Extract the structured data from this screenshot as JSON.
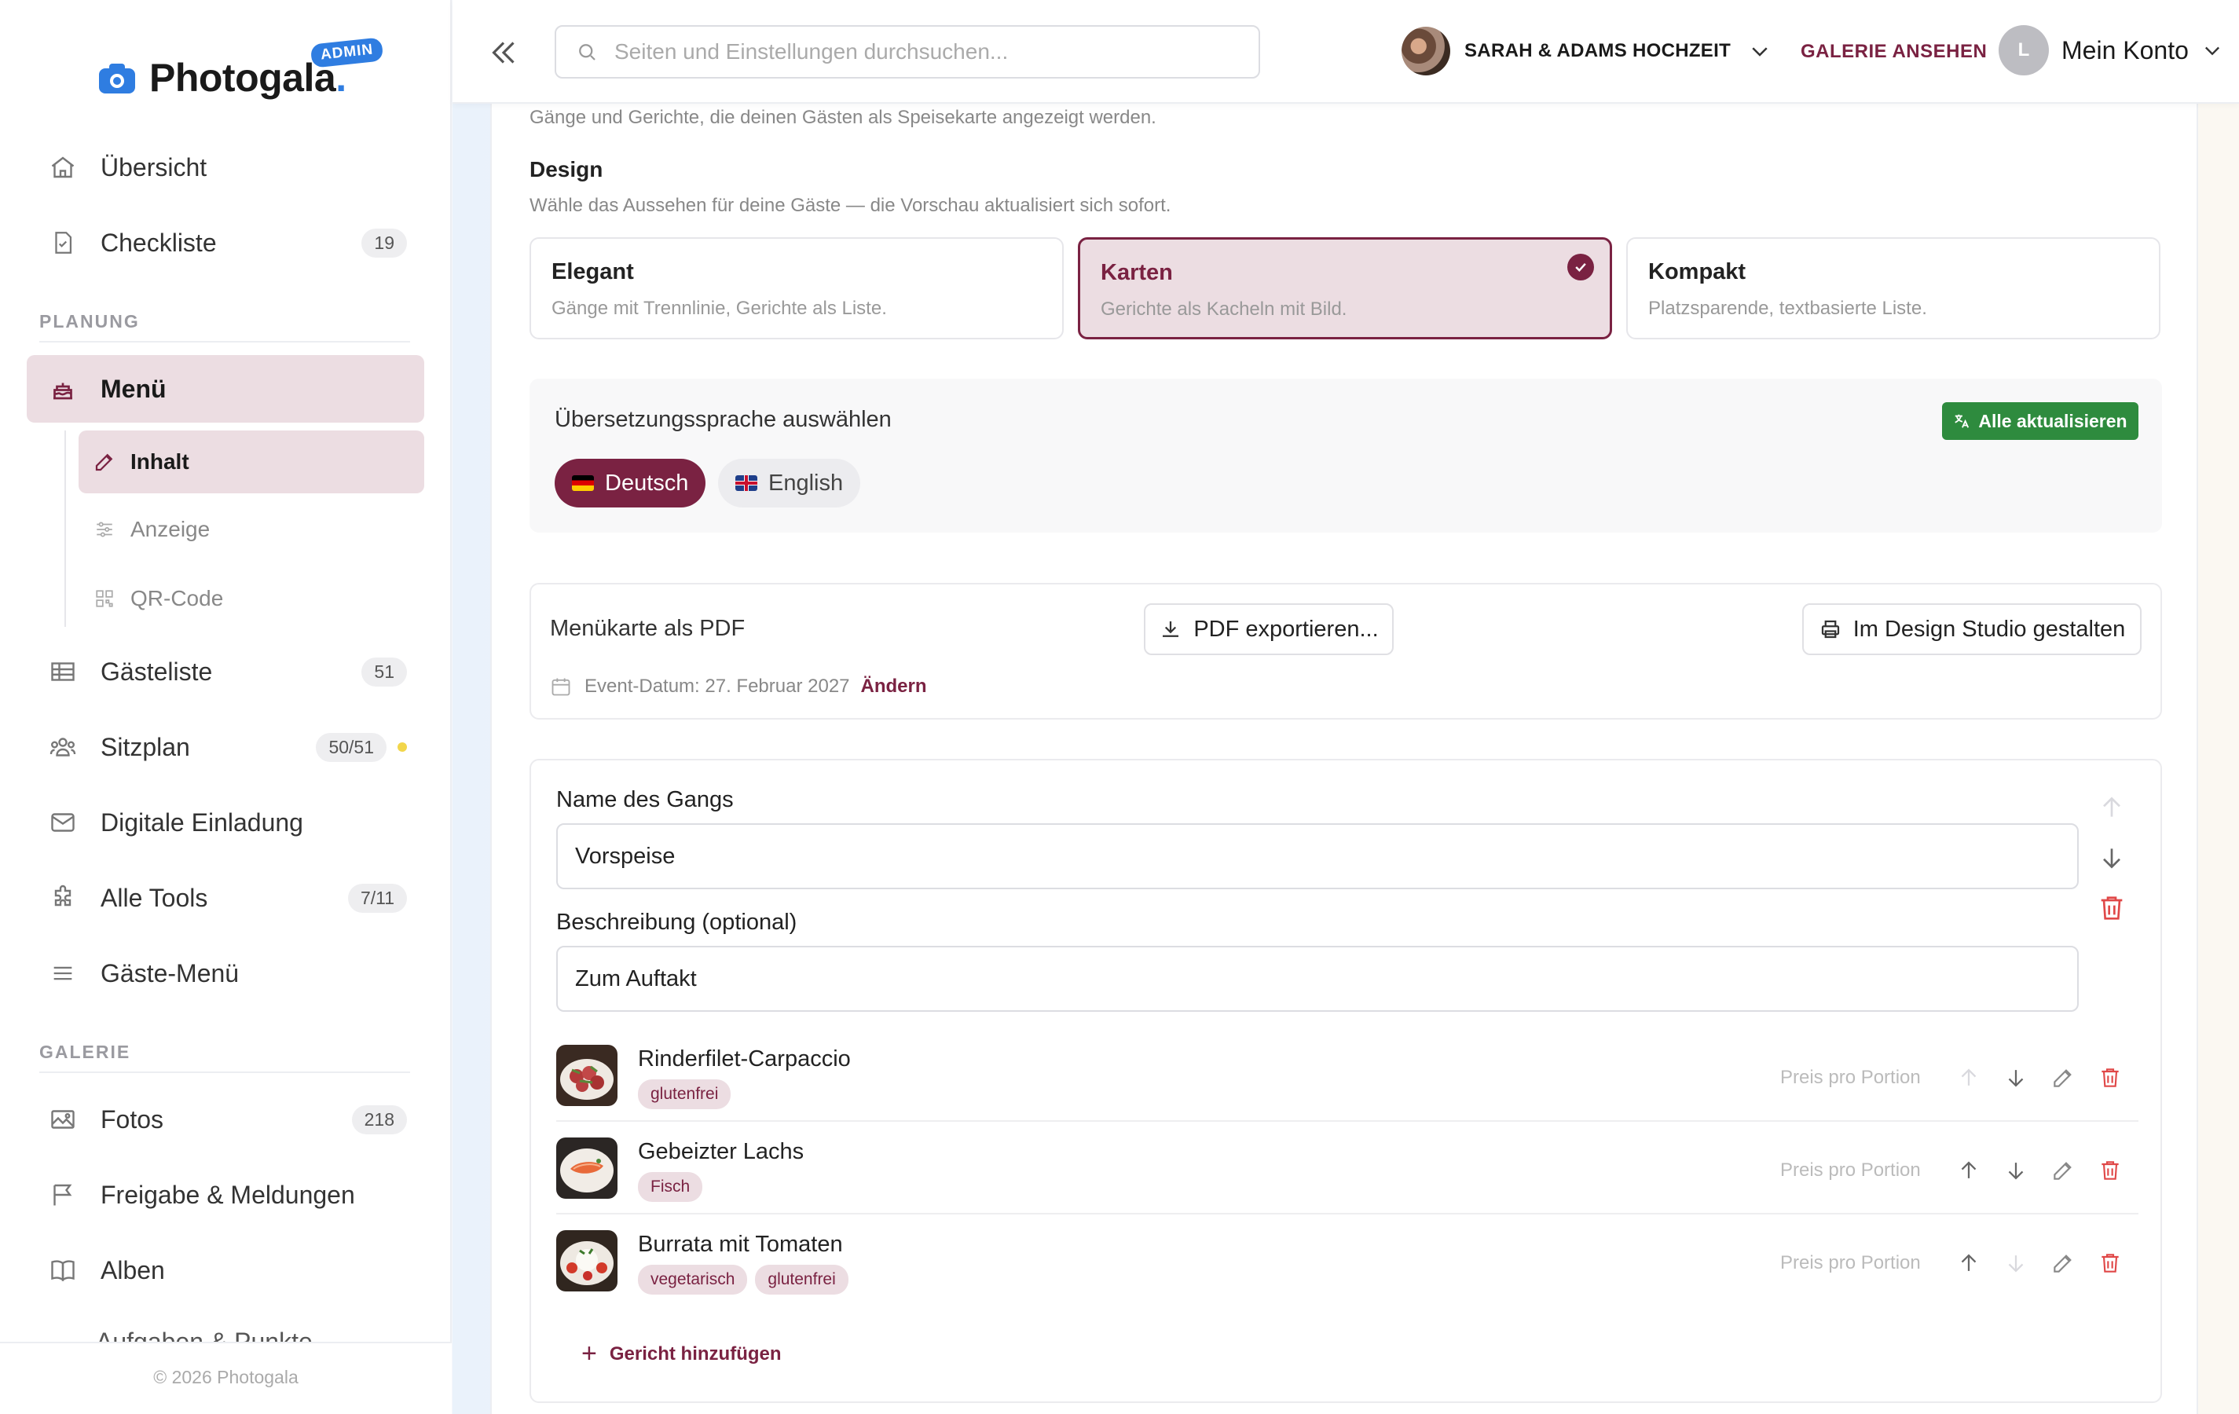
{
  "brand": {
    "name": "Photogala",
    "dot": ".",
    "badge": "ADMIN"
  },
  "sidebar": {
    "items_top": [
      {
        "label": "Übersicht",
        "icon": "home-icon"
      },
      {
        "label": "Checkliste",
        "icon": "checklist-icon",
        "count": "19"
      }
    ],
    "planning_label": "PLANUNG",
    "menu": {
      "label": "Menü",
      "icon": "cake-icon"
    },
    "menu_sub": [
      {
        "label": "Inhalt",
        "icon": "edit-icon"
      },
      {
        "label": "Anzeige",
        "icon": "sliders-icon"
      },
      {
        "label": "QR-Code",
        "icon": "qr-code-icon"
      }
    ],
    "items_planning": [
      {
        "label": "Gästeliste",
        "icon": "table-icon",
        "count": "51"
      },
      {
        "label": "Sitzplan",
        "icon": "people-icon",
        "count": "50/51"
      },
      {
        "label": "Digitale Einladung",
        "icon": "mail-icon"
      },
      {
        "label": "Alle Tools",
        "icon": "puzzle-icon",
        "count": "7/11"
      },
      {
        "label": "Gäste-Menü",
        "icon": "hamburger-icon"
      }
    ],
    "gallery_label": "GALERIE",
    "items_gallery": [
      {
        "label": "Fotos",
        "icon": "image-icon",
        "count": "218"
      },
      {
        "label": "Freigabe & Meldungen",
        "icon": "flag-icon"
      },
      {
        "label": "Alben",
        "icon": "book-icon"
      }
    ],
    "cutoff_item": "Aufgaben & Punkte",
    "footer": "© 2026 Photogala"
  },
  "topbar": {
    "search_placeholder": "Seiten und Einstellungen durchsuchen...",
    "event_name": "SARAH & ADAMS HOCHZEIT",
    "gallery_link": "GALERIE ANSEHEN",
    "account_initial": "L",
    "account_label": "Mein Konto"
  },
  "content": {
    "intro_text": "Gänge und Gerichte, die deinen Gästen als Speisekarte angezeigt werden.",
    "design_title": "Design",
    "design_desc": "Wähle das Aussehen für deine Gäste — die Vorschau aktualisiert sich sofort.",
    "designs": [
      {
        "title": "Elegant",
        "desc": "Gänge mit Trennlinie, Gerichte als Liste."
      },
      {
        "title": "Karten",
        "desc": "Gerichte als Kacheln mit Bild."
      },
      {
        "title": "Kompakt",
        "desc": "Platzsparende, textbasierte Liste."
      }
    ],
    "translation_title": "Übersetzungssprache auswählen",
    "update_all": "Alle aktualisieren",
    "languages": [
      "Deutsch",
      "English"
    ],
    "pdf_title": "Menükarte als PDF",
    "pdf_export": "PDF exportieren...",
    "design_studio": "Im Design Studio gestalten",
    "event_date": "Event-Datum: 27. Februar 2027",
    "change": "Ändern",
    "course_name_label": "Name des Gangs",
    "course_name_value": "Vorspeise",
    "course_desc_label": "Beschreibung (optional)",
    "course_desc_value": "Zum Auftakt",
    "dishes": [
      {
        "name": "Rinderfilet-Carpaccio",
        "tags": [
          "glutenfrei"
        ],
        "price_placeholder": "Preis pro Portion"
      },
      {
        "name": "Gebeizter Lachs",
        "tags": [
          "Fisch"
        ],
        "price_placeholder": "Preis pro Portion"
      },
      {
        "name": "Burrata mit Tomaten",
        "tags": [
          "vegetarisch",
          "glutenfrei"
        ],
        "price_placeholder": "Preis pro Portion"
      }
    ],
    "add_dish": "Gericht hinzufügen"
  },
  "colors": {
    "accent": "#7a2242",
    "accent_light": "#ecdde2",
    "brand_blue": "#2f7de1",
    "green": "#2e8b3e"
  }
}
